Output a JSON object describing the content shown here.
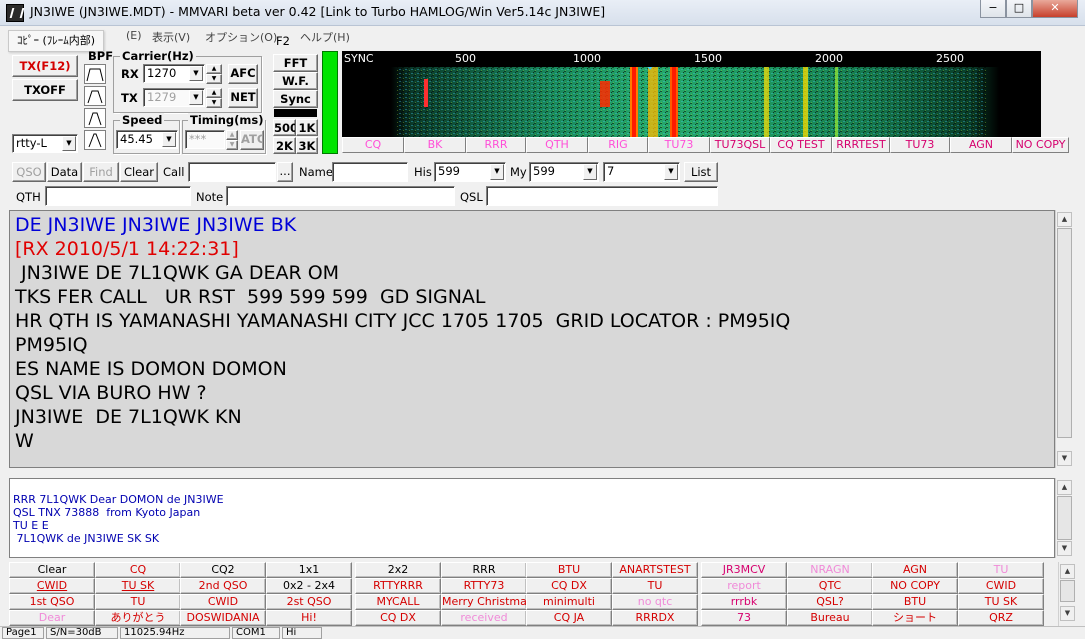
{
  "window": {
    "title": "JN3IWE (JN3IWE.MDT) - MMVARI beta ver 0.42 [Link to Turbo HAMLOG/Win Ver5.14c JN3IWE]",
    "controls": [
      "−",
      "□",
      "✕"
    ]
  },
  "menu": {
    "tooltip": "ｺﾋﾟｰ (ﾌﾚｰﾑ内部)",
    "items": [
      "(E)",
      "表示(V)",
      "オプション(O)",
      "ヘルプ(H)"
    ],
    "f2": "F2"
  },
  "tx": {
    "tx_label": "TX(F12)",
    "txoff_label": "TXOFF",
    "mode_value": "rtty-L"
  },
  "bpf": {
    "label": "BPF"
  },
  "carrier": {
    "label": "Carrier(Hz)",
    "rx_label": "RX",
    "rx_value": "1270",
    "tx_label": "TX",
    "tx_value": "1279",
    "afc_label": "AFC",
    "net_label": "NET"
  },
  "speed": {
    "label": "Speed",
    "value": "45.45"
  },
  "timing": {
    "label": "Timing(ms)",
    "value": "***",
    "atc_label": "ATC"
  },
  "display": {
    "fft_label": "FFT",
    "wf_label": "W.F.",
    "sync_label": "Sync",
    "b500": "500",
    "b1k": "1K",
    "b2k": "2K",
    "b3k": "3K"
  },
  "waterfall": {
    "sync_label": "SYNC",
    "scale": [
      "500",
      "1000",
      "1500",
      "2000",
      "2500"
    ],
    "buttons": [
      "CQ",
      "BK",
      "RRR",
      "QTH",
      "RIG",
      "TU73",
      "TU73QSL",
      "CQ TEST",
      "RRRTEST",
      "TU73",
      "AGN",
      "NO COPY"
    ]
  },
  "qso": {
    "qso_label": "QSO",
    "data_label": "Data",
    "find_label": "Find",
    "clear_label": "Clear",
    "call_label": "Call",
    "call_value": "",
    "dots_label": "...",
    "name_label": "Name",
    "name_value": "",
    "his_label": "His",
    "his_value": "599",
    "my_label": "My",
    "my_value": "599",
    "band_value": "7",
    "list_label": "List",
    "qth_label": "QTH",
    "qth_value": "",
    "note_label": "Note",
    "note_value": "",
    "qsl_label": "QSL",
    "qsl_value": ""
  },
  "rx_text": [
    {
      "text": "DE JN3IWE JN3IWE JN3IWE BK",
      "color": "#0000d8"
    },
    {
      "text": "[RX 2010/5/1 14:22:31]",
      "color": "#e00000"
    },
    {
      "text": " JN3IWE DE 7L1QWK GA DEAR OM",
      "color": "#000000"
    },
    {
      "text": "TKS FER CALL   UR RST  599 599 599  GD SIGNAL",
      "color": "#000000"
    },
    {
      "text": "HR QTH IS YAMANASHI YAMANASHI CITY JCC 1705 1705  GRID LOCATOR : PM95IQ",
      "color": "#000000"
    },
    {
      "text": "PM95IQ",
      "color": "#000000"
    },
    {
      "text": "ES NAME IS DOMON DOMON",
      "color": "#000000"
    },
    {
      "text": "QSL VIA BURO HW ?",
      "color": "#000000"
    },
    {
      "text": "JN3IWE  DE 7L1QWK KN",
      "color": "#000000"
    },
    {
      "text": "W",
      "color": "#000000"
    }
  ],
  "tx_text": [
    "RRR 7L1QWK Dear DOMON de JN3IWE",
    "QSL TNX 73888  from Kyoto Japan",
    "TU E E",
    " 7L1QWK de JN3IWE SK SK"
  ],
  "macro_rows": [
    [
      {
        "label": "Clear",
        "c": "blk"
      },
      {
        "label": "CQ",
        "c": "red"
      },
      {
        "label": "CQ2",
        "c": "blk"
      },
      {
        "label": "1x1",
        "c": "blk"
      },
      {
        "label": "2x2",
        "c": "blk"
      },
      {
        "label": "RRR",
        "c": "blk"
      },
      {
        "label": "BTU",
        "c": "red"
      },
      {
        "label": "ANARTSTEST",
        "c": "red"
      },
      {
        "label": "JR3MCV",
        "c": "mag"
      },
      {
        "label": "NRAGN",
        "c": "pink"
      },
      {
        "label": "AGN",
        "c": "red"
      },
      {
        "label": "TU",
        "c": "pink"
      }
    ],
    [
      {
        "label": "CWID",
        "c": "red u"
      },
      {
        "label": "TU SK",
        "c": "red u"
      },
      {
        "label": "2nd QSO",
        "c": "red"
      },
      {
        "label": "0x2 - 2x4",
        "c": "blk"
      },
      {
        "label": "RTTYRRR",
        "c": "red"
      },
      {
        "label": "RTTY73",
        "c": "red"
      },
      {
        "label": "CQ DX",
        "c": "red"
      },
      {
        "label": "TU",
        "c": "red"
      },
      {
        "label": "report",
        "c": "pink"
      },
      {
        "label": "QTC",
        "c": "red"
      },
      {
        "label": "NO COPY",
        "c": "red"
      },
      {
        "label": "CWID",
        "c": "red"
      }
    ],
    [
      {
        "label": "1st QSO",
        "c": "red"
      },
      {
        "label": "TU",
        "c": "red"
      },
      {
        "label": "CWID",
        "c": "red"
      },
      {
        "label": "2st QSO",
        "c": "red"
      },
      {
        "label": "MYCALL",
        "c": "red"
      },
      {
        "label": "Merry Christmas",
        "c": "red"
      },
      {
        "label": "minimulti",
        "c": "red"
      },
      {
        "label": "no qtc",
        "c": "pink"
      },
      {
        "label": "rrrbk",
        "c": "mag"
      },
      {
        "label": "QSL?",
        "c": "red"
      },
      {
        "label": "BTU",
        "c": "red"
      },
      {
        "label": "TU SK",
        "c": "red"
      }
    ],
    [
      {
        "label": "Dear",
        "c": "pink"
      },
      {
        "label": "ありがとう",
        "c": "red"
      },
      {
        "label": "DOSWIDANIA",
        "c": "red"
      },
      {
        "label": "Hi!",
        "c": "red"
      },
      {
        "label": "CQ DX",
        "c": "red"
      },
      {
        "label": "received",
        "c": "pink"
      },
      {
        "label": "CQ JA",
        "c": "red"
      },
      {
        "label": "RRRDX",
        "c": "red"
      },
      {
        "label": "73",
        "c": "mag"
      },
      {
        "label": "Bureau",
        "c": "red"
      },
      {
        "label": "ショート",
        "c": "red"
      },
      {
        "label": "QRZ",
        "c": "red"
      }
    ]
  ],
  "status": [
    "Page1",
    "S/N=30dB",
    "11025.94Hz",
    "COM1",
    "Hi"
  ]
}
